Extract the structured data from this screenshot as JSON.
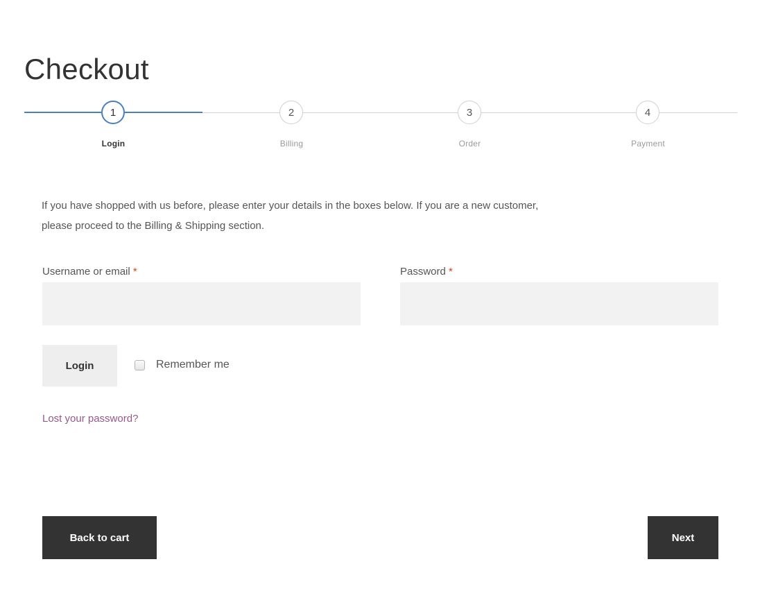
{
  "page": {
    "title": "Checkout"
  },
  "steps": [
    {
      "number": "1",
      "label": "Login",
      "active": true
    },
    {
      "number": "2",
      "label": "Billing",
      "active": false
    },
    {
      "number": "3",
      "label": "Order",
      "active": false
    },
    {
      "number": "4",
      "label": "Payment",
      "active": false
    }
  ],
  "intro": {
    "line1": "If you have shopped with us before, please enter your details in the boxes below. If you are a new customer,",
    "line2": "please proceed to the Billing & Shipping section."
  },
  "form": {
    "username_label": "Username or email",
    "password_label": "Password",
    "required_mark": "*",
    "username_value": "",
    "password_value": "",
    "login_button": "Login",
    "remember_label": "Remember me",
    "remember_checked": false,
    "lost_password_link": "Lost your password?"
  },
  "nav": {
    "back_button": "Back to cart",
    "next_button": "Next"
  },
  "colors": {
    "accent": "#4a7fc1",
    "link": "#96588a",
    "required": "#e2401c",
    "dark_button": "#333333"
  }
}
